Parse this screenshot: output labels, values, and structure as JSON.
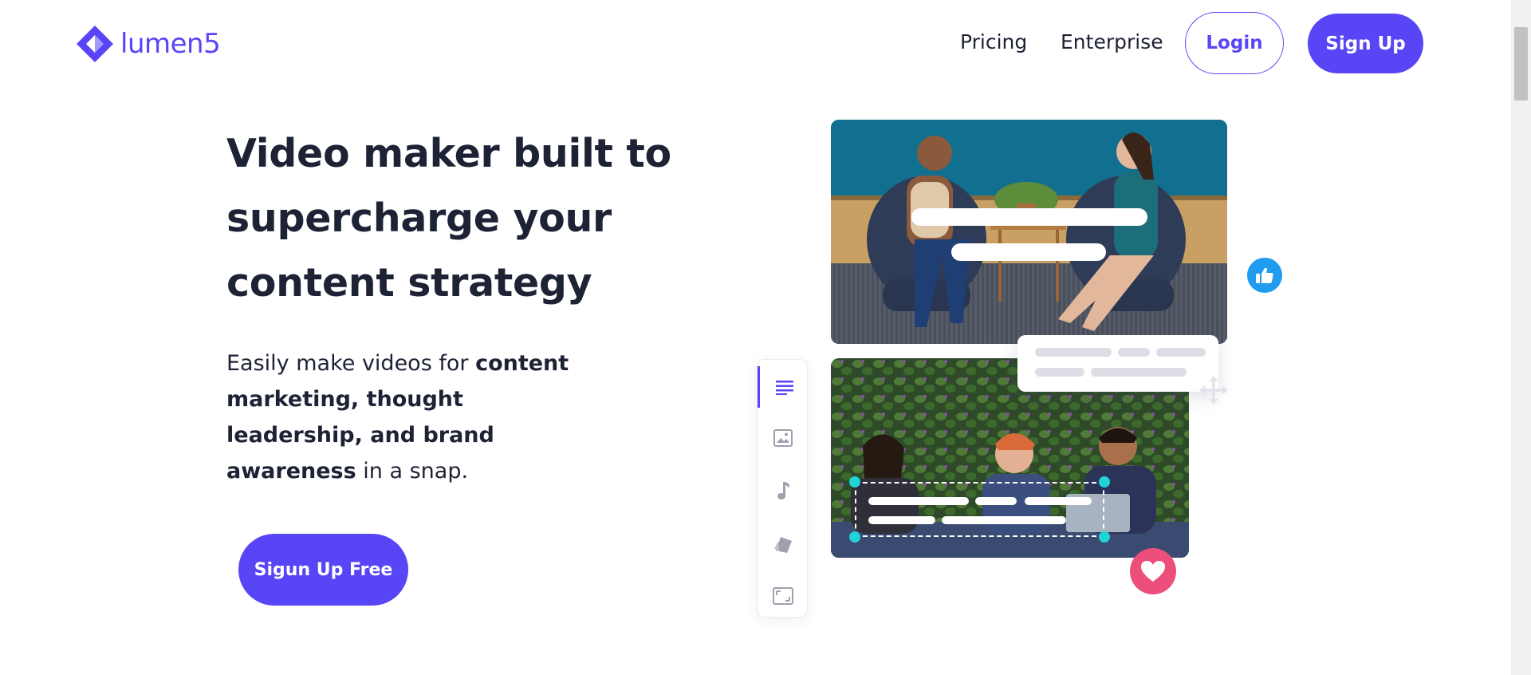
{
  "brand": {
    "name": "lumen5",
    "accent": "#5846f6"
  },
  "nav": {
    "pricing": "Pricing",
    "enterprise": "Enterprise",
    "login": "Login",
    "signup": "Sign Up"
  },
  "hero": {
    "headline": "Video maker built to supercharge your content strategy",
    "sub_prefix": "Easily make videos for ",
    "sub_bold": "content marketing, thought leadership, and brand awareness",
    "sub_suffix": " in a snap.",
    "cta": "Sigun Up Free"
  },
  "icons": {
    "logo": "lumen5-logo-icon",
    "toolbar": [
      "text-icon",
      "image-icon",
      "music-icon",
      "style-icon",
      "resize-icon"
    ],
    "like": "thumbs-up-icon",
    "heart": "heart-icon",
    "move": "move-icon"
  },
  "colors": {
    "text": "#1e2235",
    "like_badge": "#1f9bf0",
    "heart_badge": "#ec4f7b",
    "handle": "#22d3d6"
  }
}
